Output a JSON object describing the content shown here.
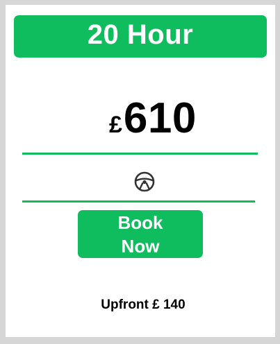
{
  "plan": {
    "title": "20 Hour",
    "currency_symbol": "£",
    "price": "610",
    "feature_icon": "steering-wheel-icon",
    "book_button": {
      "line1": "Book",
      "line2": "Now"
    },
    "upfront_text": "Upfront £ 140"
  },
  "colors": {
    "accent": "#0fbd5f",
    "background": "#d6d6d6",
    "card": "#ffffff",
    "text": "#000000",
    "icon": "#333333"
  }
}
